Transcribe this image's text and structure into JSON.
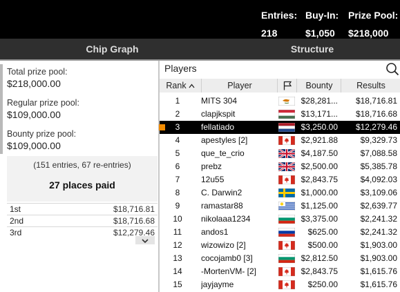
{
  "header": {
    "stats": [
      {
        "label": "Entries:",
        "value": "218"
      },
      {
        "label": "Buy-In:",
        "value": "$1,050"
      },
      {
        "label": "Prize Pool:",
        "value": "$218,000"
      }
    ]
  },
  "tabs": {
    "chip_graph": "Chip Graph",
    "structure": "Structure"
  },
  "prizes": {
    "total_label": "Total prize pool:",
    "total_value": "$218,000.00",
    "regular_label": "Regular prize pool:",
    "regular_value": "$109,000.00",
    "bounty_label": "Bounty prize pool:",
    "bounty_value": "$109,000.00",
    "entries_note": "(151 entries, 67 re-entries)",
    "places_paid": "27 places paid",
    "payouts": [
      {
        "place": "1st",
        "amount": "$18,716.81"
      },
      {
        "place": "2nd",
        "amount": "$18,716.68"
      },
      {
        "place": "3rd",
        "amount": "$12,279.46"
      }
    ]
  },
  "players": {
    "title": "Players",
    "columns": {
      "rank": "Rank",
      "player": "Player",
      "bounty": "Bounty",
      "results": "Results"
    },
    "rows": [
      {
        "rank": "1",
        "player": "MITS 304",
        "flag": "cyprus",
        "bounty": "$28,281...",
        "results": "$18,716.81"
      },
      {
        "rank": "2",
        "player": "clapjkspit",
        "flag": "hungary",
        "bounty": "$13,171...",
        "results": "$18,716.68"
      },
      {
        "rank": "3",
        "player": "fellatiado",
        "flag": "netherlands",
        "bounty": "$3,250.00",
        "results": "$12,279.46",
        "highlight": true
      },
      {
        "rank": "4",
        "player": "apestyles [2]",
        "flag": "canada",
        "bounty": "$2,921.88",
        "results": "$9,329.73"
      },
      {
        "rank": "5",
        "player": "que_te_crio",
        "flag": "uk",
        "bounty": "$4,187.50",
        "results": "$7,088.58"
      },
      {
        "rank": "6",
        "player": "prebz",
        "flag": "uk",
        "bounty": "$2,500.00",
        "results": "$5,385.78"
      },
      {
        "rank": "7",
        "player": "12u55",
        "flag": "canada",
        "bounty": "$2,843.75",
        "results": "$4,092.03"
      },
      {
        "rank": "8",
        "player": "C. Darwin2",
        "flag": "sweden",
        "bounty": "$1,000.00",
        "results": "$3,109.06"
      },
      {
        "rank": "9",
        "player": "ramastar88",
        "flag": "uruguay",
        "bounty": "$1,125.00",
        "results": "$2,639.77"
      },
      {
        "rank": "10",
        "player": "nikolaaa1234",
        "flag": "bulgaria",
        "bounty": "$3,375.00",
        "results": "$2,241.32"
      },
      {
        "rank": "11",
        "player": "andos1",
        "flag": "russia",
        "bounty": "$625.00",
        "results": "$2,241.32"
      },
      {
        "rank": "12",
        "player": "wizowizo [2]",
        "flag": "canada",
        "bounty": "$500.00",
        "results": "$1,903.00"
      },
      {
        "rank": "13",
        "player": "cocojamb0 [3]",
        "flag": "bulgaria",
        "bounty": "$2,812.50",
        "results": "$1,903.00"
      },
      {
        "rank": "14",
        "player": "-MortenVM- [2]",
        "flag": "canada",
        "bounty": "$2,843.75",
        "results": "$1,615.76"
      },
      {
        "rank": "15",
        "player": "jayjayme",
        "flag": "canada",
        "bounty": "$250.00",
        "results": "$1,615.76"
      }
    ]
  },
  "icons": {
    "search": "search-icon",
    "sort": "sort-ascending-icon",
    "flag_column": "flag-icon",
    "expand": "chevron-down-icon",
    "highlight_marker": "orange-square-marker"
  },
  "colors": {
    "header_bg": "#000000",
    "tab_bg": "#2f2f2f",
    "highlight_row": "#000000",
    "marker": "#f08a00"
  }
}
